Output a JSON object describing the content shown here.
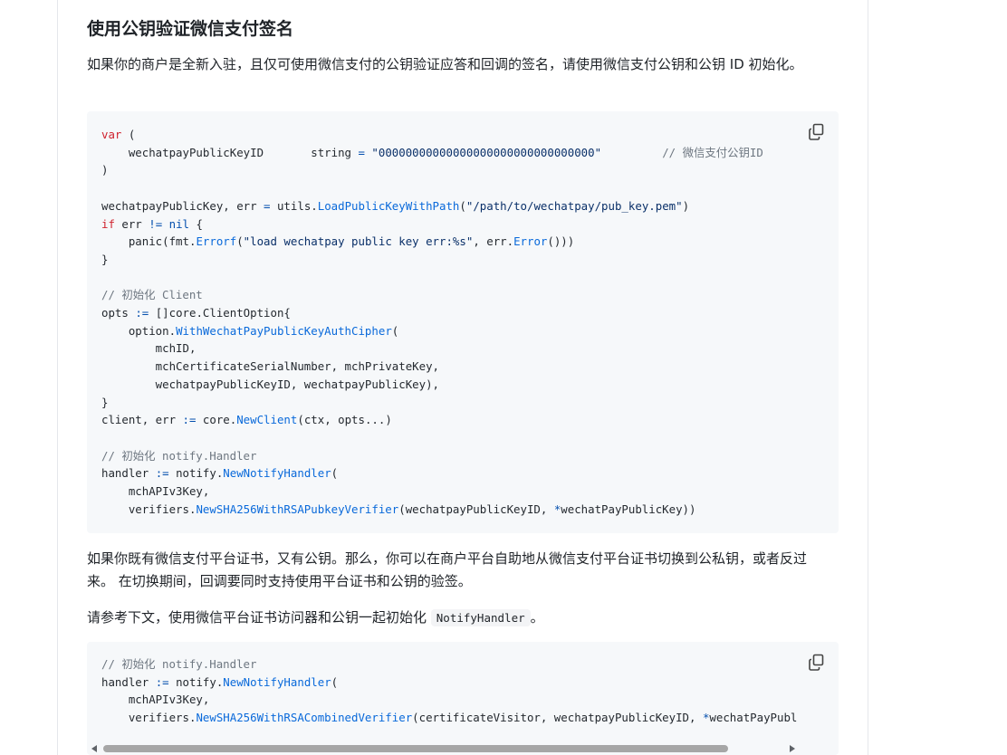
{
  "heading": "使用公钥验证微信支付签名",
  "intro": "如果你的商户是全新入驻，且仅可使用微信支付的公钥验证应答和回调的签名，请使用微信支付公钥和公钥 ID 初始化。",
  "paragraph2": "如果你既有微信支付平台证书，又有公钥。那么，你可以在商户平台自助地从微信支付平台证书切换到公私钥，或者反过来。 在切换期间，回调要同时支持使用平台证书和公钥的验签。",
  "paragraph3_before": "请参考下文，使用微信平台证书访问器和公钥一起初始化 ",
  "paragraph3_code": "NotifyHandler",
  "paragraph3_after": "。",
  "code1": {
    "copy_icon": "copy-icon",
    "tokens": {
      "var": "var",
      "if": "if",
      "pubkey_id_str": "\"00000000000000000000000000000000\"",
      "pem_path": "\"/path/to/wechatpay/pub_key.pem\"",
      "err_fmt": "\"load wechatpay public key err:%s\"",
      "comment_pubkey_id": "// 微信支付公钥ID",
      "comment_client": "// 初始化 Client",
      "comment_handler": "// 初始化 notify.Handler"
    }
  },
  "code2": {
    "copy_icon": "copy-icon",
    "comment_handler": "// 初始化 notify.Handler"
  },
  "colors": {
    "keyword": "#cf222e",
    "function": "#0969da",
    "string": "#0a3069",
    "comment": "#6e7781",
    "code_bg": "#f6f8fa"
  }
}
